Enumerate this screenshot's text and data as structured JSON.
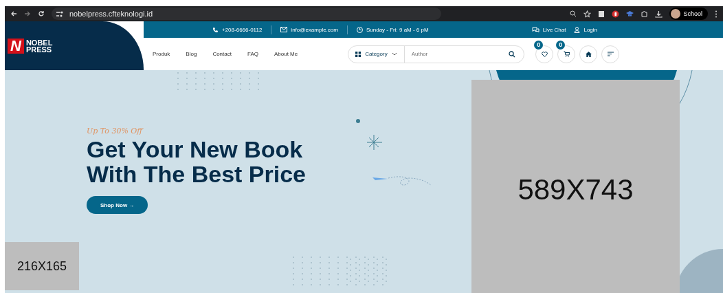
{
  "browser": {
    "url": "nobelpress.cfteknologi.id",
    "profile": "School"
  },
  "topbar": {
    "phone": "+208-6666-0112",
    "email": "info@example.com",
    "hours": "Sunday - Fri: 9 aM - 6 pM",
    "live_chat": "Live Chat",
    "login": "Login"
  },
  "logo": {
    "mark": "N",
    "lines": [
      "NOBEL",
      "PRESS"
    ]
  },
  "nav": [
    "Produk",
    "Blog",
    "Contact",
    "FAQ",
    "About Me"
  ],
  "search": {
    "category": "Category",
    "placeholder": "Author"
  },
  "wishlist_count": "0",
  "cart_count": "0",
  "hero": {
    "eyebrow": "Up To 30% Off",
    "title": [
      "Get Your New Book",
      "With The Best Price"
    ],
    "button": "Shop Now →",
    "main_image": "589X743",
    "small_image": "216X165"
  }
}
